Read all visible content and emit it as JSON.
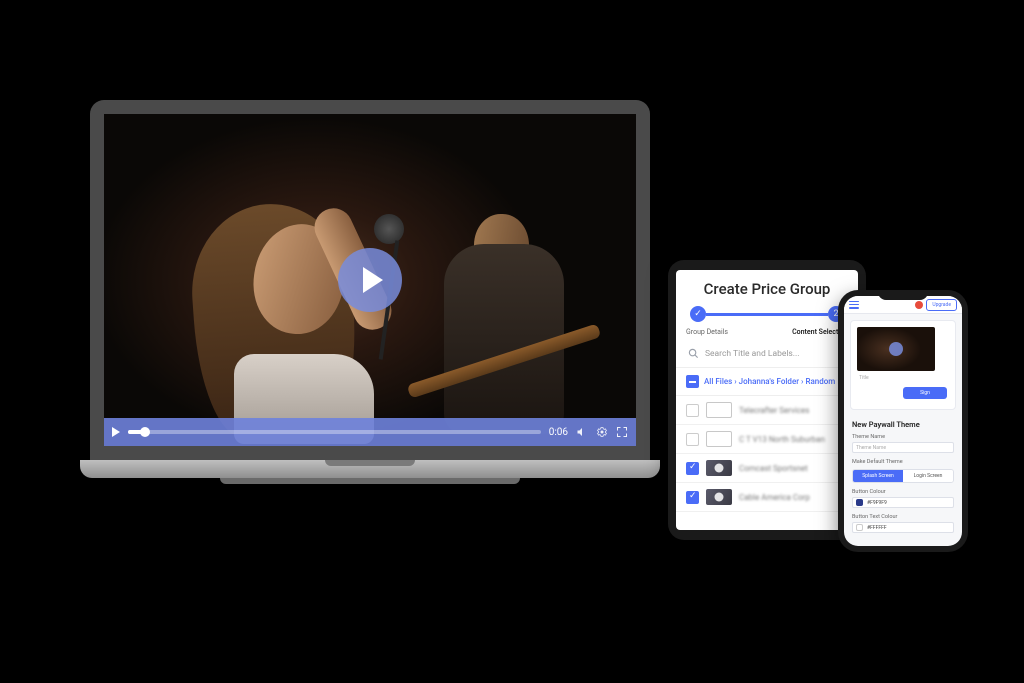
{
  "colors": {
    "primary": "#4a6cf7",
    "text": "#333333"
  },
  "laptop": {
    "player": {
      "time": "0:06"
    }
  },
  "tablet": {
    "title": "Create Price Group",
    "steps": {
      "one": {
        "label": "Group Details"
      },
      "two": {
        "label": "Content Selection",
        "number": "2"
      }
    },
    "search_placeholder": "Search Title and Labels...",
    "breadcrumb": "All Files › Johanna's Folder › Random",
    "rows": [
      {
        "type": "folder",
        "checked": false,
        "label": "Telecrafter Services"
      },
      {
        "type": "folder",
        "checked": false,
        "label": "C T V13 North Suburban"
      },
      {
        "type": "video",
        "checked": true,
        "label": "Comcast Sportsnet"
      },
      {
        "type": "video",
        "checked": true,
        "label": "Cable America Corp"
      }
    ]
  },
  "phone": {
    "upgrade": "Upgrade",
    "preview": {
      "title_placeholder": "Title",
      "sign_label": "Sign"
    },
    "section_title": "New Paywall Theme",
    "theme_name_label": "Theme Name",
    "theme_name_placeholder": "Theme Name",
    "default_label": "Make Default Theme",
    "tabs": {
      "splash": "Splash Screen",
      "login": "Login Screen"
    },
    "button_colour_label": "Button Colour",
    "button_colour_value": "#F9F9F9",
    "button_text_colour_label": "Button Text Colour",
    "button_text_colour_value": "#FFFFFF"
  }
}
